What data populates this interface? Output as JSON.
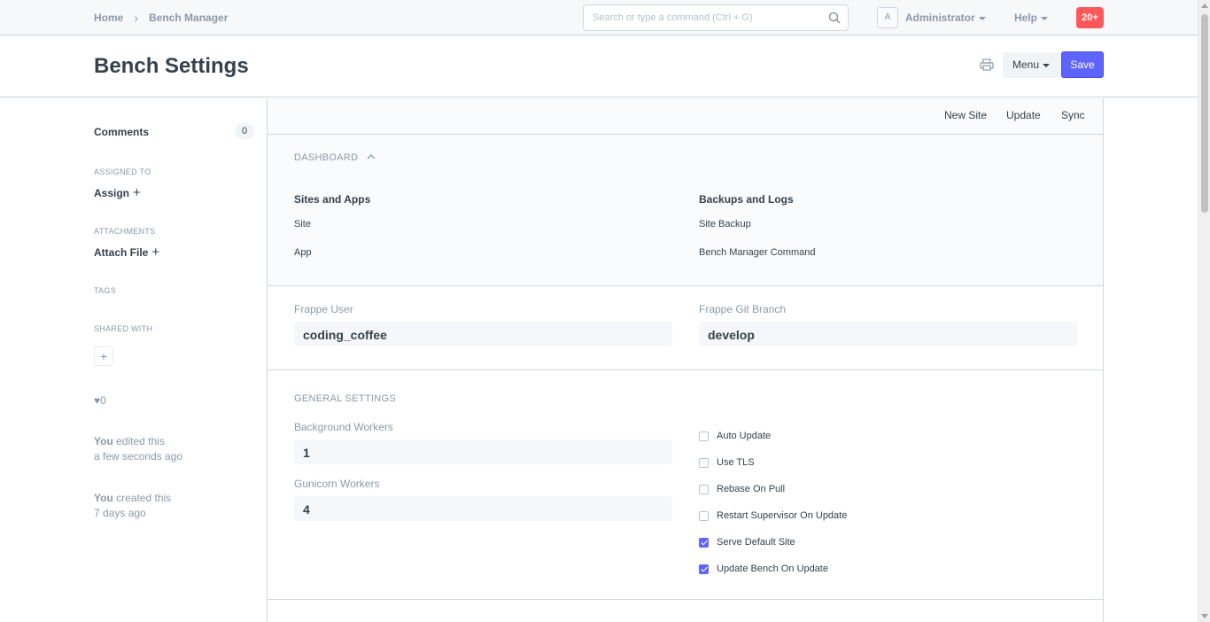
{
  "navbar": {
    "breadcrumbs": [
      "Home",
      "Bench Manager"
    ],
    "search_placeholder": "Search or type a command (Ctrl + G)",
    "avatar_letter": "A",
    "user": "Administrator",
    "help": "Help",
    "notifications": "20+"
  },
  "page": {
    "title": "Bench Settings",
    "menu_label": "Menu",
    "save_label": "Save"
  },
  "sidebar": {
    "comments_label": "Comments",
    "comments_count": "0",
    "assigned_to_label": "ASSIGNED TO",
    "assign_label": "Assign",
    "attachments_label": "ATTACHMENTS",
    "attach_label": "Attach File",
    "tags_label": "TAGS",
    "shared_with_label": "SHARED WITH",
    "likes": "0",
    "activity": [
      {
        "who": "You",
        "action": "edited this",
        "when": "a few seconds ago"
      },
      {
        "who": "You",
        "action": "created this",
        "when": "7 days ago"
      }
    ]
  },
  "form": {
    "toolbar": [
      "New Site",
      "Update",
      "Sync"
    ],
    "dashboard": {
      "heading": "DASHBOARD",
      "columns": [
        {
          "title": "Sites and Apps",
          "links": [
            "Site",
            "App"
          ]
        },
        {
          "title": "Backups and Logs",
          "links": [
            "Site Backup",
            "Bench Manager Command"
          ]
        }
      ]
    },
    "frappe_user": {
      "label": "Frappe User",
      "value": "coding_coffee"
    },
    "frappe_git_branch": {
      "label": "Frappe Git Branch",
      "value": "develop"
    },
    "general_settings": {
      "heading": "GENERAL SETTINGS",
      "background_workers": {
        "label": "Background Workers",
        "value": "1"
      },
      "gunicorn_workers": {
        "label": "Gunicorn Workers",
        "value": "4"
      },
      "checkboxes": [
        {
          "label": "Auto Update",
          "checked": false
        },
        {
          "label": "Use TLS",
          "checked": false
        },
        {
          "label": "Rebase On Pull",
          "checked": false
        },
        {
          "label": "Restart Supervisor On Update",
          "checked": false
        },
        {
          "label": "Serve Default Site",
          "checked": true
        },
        {
          "label": "Update Bench On Update",
          "checked": true
        }
      ]
    }
  },
  "colors": {
    "primary": "#5e64ff",
    "notification": "#ff5858",
    "text": "#36414c",
    "muted": "#8d99a6"
  }
}
